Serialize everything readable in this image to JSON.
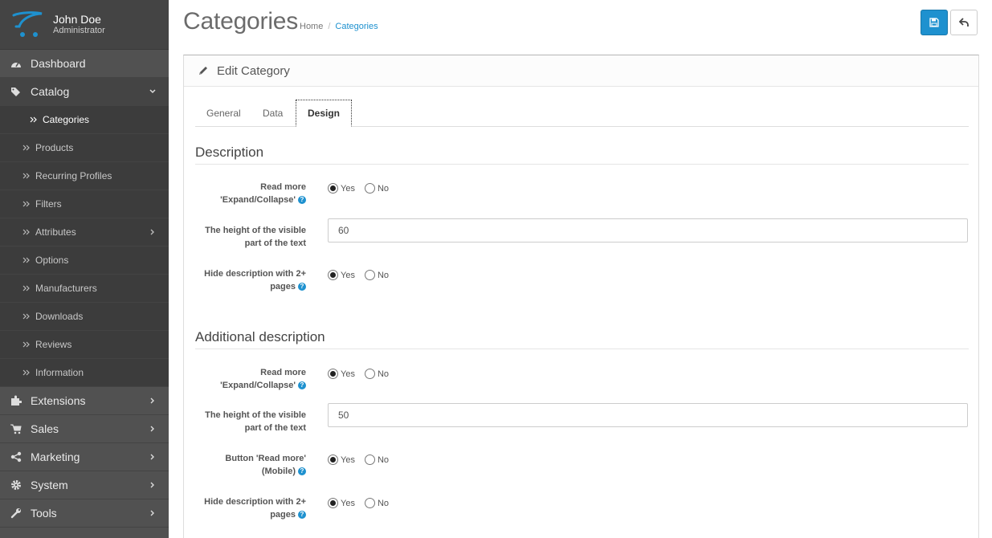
{
  "profile": {
    "name": "John Doe",
    "role": "Administrator"
  },
  "sidebar": {
    "dashboard": "Dashboard",
    "catalog": "Catalog",
    "catalog_items": [
      "Categories",
      "Products",
      "Recurring Profiles",
      "Filters",
      "Attributes",
      "Options",
      "Manufacturers",
      "Downloads",
      "Reviews",
      "Information"
    ],
    "extensions": "Extensions",
    "sales": "Sales",
    "marketing": "Marketing",
    "system": "System",
    "tools": "Tools"
  },
  "header": {
    "title": "Categories",
    "breadcrumb": [
      "Home",
      "Categories"
    ]
  },
  "panel": {
    "title": "Edit Category"
  },
  "tabs": [
    "General",
    "Data",
    "Design"
  ],
  "description": {
    "title": "Description",
    "read_more_label_1": "Read more",
    "read_more_label_2": "'Expand/Collapse'",
    "height_label_1": "The height of the visible",
    "height_label_2": "part of the text",
    "height_value": "60",
    "hide_label_1": "Hide description with 2+",
    "hide_label_2": "pages"
  },
  "additional": {
    "title": "Additional description",
    "read_more_label_1": "Read more",
    "read_more_label_2": "'Expand/Collapse'",
    "height_label_1": "The height of the visible",
    "height_label_2": "part of the text",
    "height_value": "50",
    "mobile_label_1": "Button 'Read more'",
    "mobile_label_2": "(Mobile)",
    "hide_label_1": "Hide description with 2+",
    "hide_label_2": "pages"
  },
  "radio": {
    "yes": "Yes",
    "no": "No"
  },
  "colors": {
    "sidebar": "#515151",
    "accent": "#1e91cf"
  }
}
